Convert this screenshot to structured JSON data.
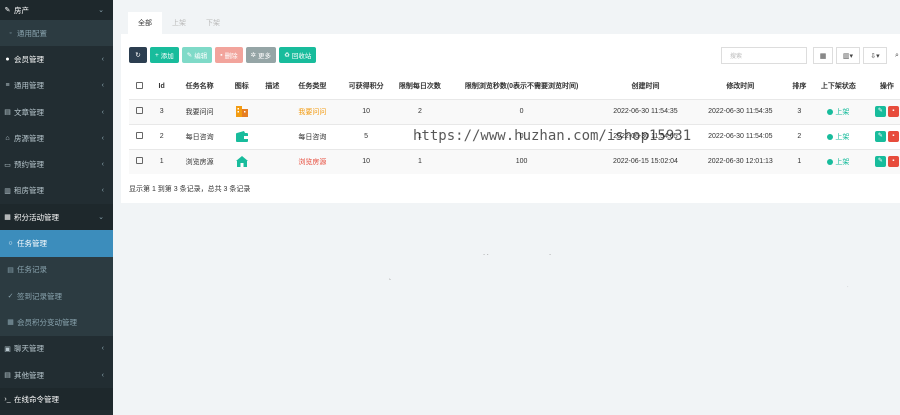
{
  "sidebar": {
    "items": [
      {
        "label": "房产",
        "icon": "edit-icon",
        "kind": "top"
      },
      {
        "label": "通用配置",
        "icon": "circle-icon",
        "kind": "sub"
      },
      {
        "label": "会员管理",
        "icon": "user-circle-icon",
        "kind": "top"
      },
      {
        "label": "通用管理",
        "icon": "list-icon",
        "kind": "top"
      },
      {
        "label": "文章管理",
        "icon": "file-icon",
        "kind": "top"
      },
      {
        "label": "房源管理",
        "icon": "home-icon",
        "kind": "top"
      },
      {
        "label": "预约管理",
        "icon": "calendar-icon",
        "kind": "top"
      },
      {
        "label": "租房管理",
        "icon": "building-icon",
        "kind": "top"
      },
      {
        "label": "积分活动管理",
        "icon": "gift-icon",
        "kind": "open"
      },
      {
        "label": "任务管理",
        "icon": "circle-o-icon",
        "kind": "active"
      },
      {
        "label": "任务记录",
        "icon": "list-alt-icon",
        "kind": "sub"
      },
      {
        "label": "签到记录管理",
        "icon": "check-icon",
        "kind": "sub"
      },
      {
        "label": "会员积分变动管理",
        "icon": "table-icon",
        "kind": "sub"
      },
      {
        "label": "聊天管理",
        "icon": "comments-icon",
        "kind": "top"
      },
      {
        "label": "其他管理",
        "icon": "cog-icon",
        "kind": "top"
      },
      {
        "label": "在线命令管理",
        "icon": "terminal-icon",
        "kind": "top"
      }
    ]
  },
  "tabs": [
    "全部",
    "上架",
    "下架"
  ],
  "toolbar": {
    "refresh": "",
    "add": "添加",
    "edit": "编辑",
    "delete": "删除",
    "more": "更多",
    "recycle": "回收站"
  },
  "search": {
    "placeholder": "搜索"
  },
  "table": {
    "headers": [
      "Id",
      "任务名称",
      "图标",
      "描述",
      "任务类型",
      "可获得积分",
      "限制每日次数",
      "限制浏览秒数(0表示不需要浏览时间)",
      "创建时间",
      "修改时间",
      "排序",
      "上下架状态",
      "操作"
    ],
    "rows": [
      {
        "id": "3",
        "name": "我要问问",
        "desc": "",
        "type": "我要问问",
        "points": "10",
        "daily": "2",
        "seconds": "0",
        "created": "2022-06-30 11:54:35",
        "updated": "2022-06-30 11:54:35",
        "sort": "3",
        "status": "上架",
        "icon_color": "#f39c12"
      },
      {
        "id": "2",
        "name": "每日咨询",
        "desc": "",
        "type": "每日咨询",
        "points": "5",
        "daily": "1",
        "seconds": "0",
        "created": "2022-06-30 11:54:05",
        "updated": "2022-06-30 11:54:05",
        "sort": "2",
        "status": "上架",
        "icon_color": "#18bc9c"
      },
      {
        "id": "1",
        "name": "浏览房源",
        "desc": "",
        "type": "浏览房源",
        "points": "10",
        "daily": "1",
        "seconds": "100",
        "created": "2022-06-15 15:02:04",
        "updated": "2022-06-30 12:01:13",
        "sort": "1",
        "status": "上架",
        "icon_color": "#18bc9c"
      }
    ]
  },
  "pager": {
    "text": "显示第 1 到第 3 条记录，总共 3 条记录"
  },
  "watermark": {
    "text": "https://www.huzhan.com/ishop15931"
  },
  "colors": {
    "sidebar": "#222d32",
    "accent": "#3c8dbc",
    "success": "#18bc9c",
    "danger": "#e74c3c",
    "warning": "#f39c12"
  }
}
